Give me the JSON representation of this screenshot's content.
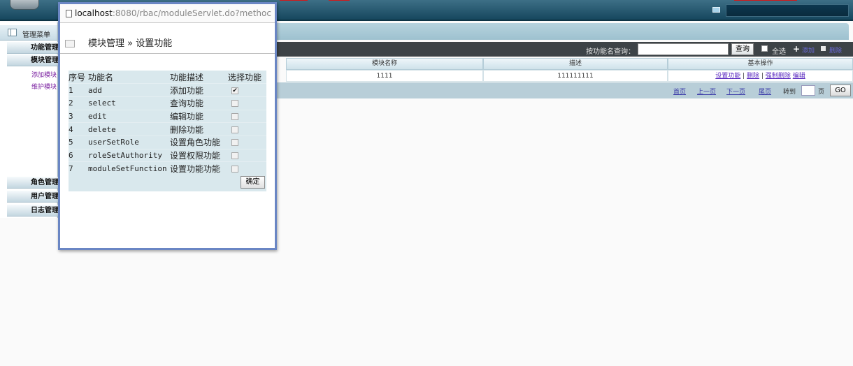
{
  "banner": {},
  "sidebar": {
    "menu_title": "管理菜单",
    "groups": [
      "功能管理",
      "模块管理",
      "角色管理",
      "用户管理",
      "日志管理"
    ],
    "links": [
      "添加模块",
      "维护模块"
    ]
  },
  "toolbar": {
    "search_label": "按功能名查询：",
    "search_button": "查询",
    "select_all": "全选",
    "add_label": "添加",
    "delete_label": "删除"
  },
  "grid": {
    "columns": [
      "模块名称",
      "描述",
      "基本操作"
    ],
    "rows": [
      {
        "name": "1111",
        "description": "111111111",
        "ops": [
          "设置功能",
          "删除",
          "强制删除",
          "编辑"
        ]
      }
    ]
  },
  "pager": {
    "first": "首页",
    "prev": "上一页",
    "next": "下一页",
    "last": "尾页",
    "goto_label": "转到",
    "page_unit": "页",
    "go_button": "GO"
  },
  "popup": {
    "url_host": "localhost",
    "url_path": ":8080/rbac/moduleServlet.do?methoc",
    "breadcrumb": "模块管理 » 设置功能",
    "headers": [
      "序号",
      "功能名",
      "功能描述",
      "选择功能"
    ],
    "rows": [
      {
        "no": "1",
        "name": "add",
        "desc": "添加功能",
        "checked": true
      },
      {
        "no": "2",
        "name": "select",
        "desc": "查询功能",
        "checked": false
      },
      {
        "no": "3",
        "name": "edit",
        "desc": "编辑功能",
        "checked": false
      },
      {
        "no": "4",
        "name": "delete",
        "desc": "删除功能",
        "checked": false
      },
      {
        "no": "5",
        "name": "userSetRole",
        "desc": "设置角色功能",
        "checked": false
      },
      {
        "no": "6",
        "name": "roleSetAuthority",
        "desc": "设置权限功能",
        "checked": false
      },
      {
        "no": "7",
        "name": "moduleSetFunction",
        "desc": "设置功能功能",
        "checked": false
      }
    ],
    "confirm": "确定"
  },
  "colors": {
    "banner": "#16475e",
    "popup_border": "#6a86c4",
    "row_bg": "#d9e8ed",
    "link": "#5b2bc0"
  }
}
